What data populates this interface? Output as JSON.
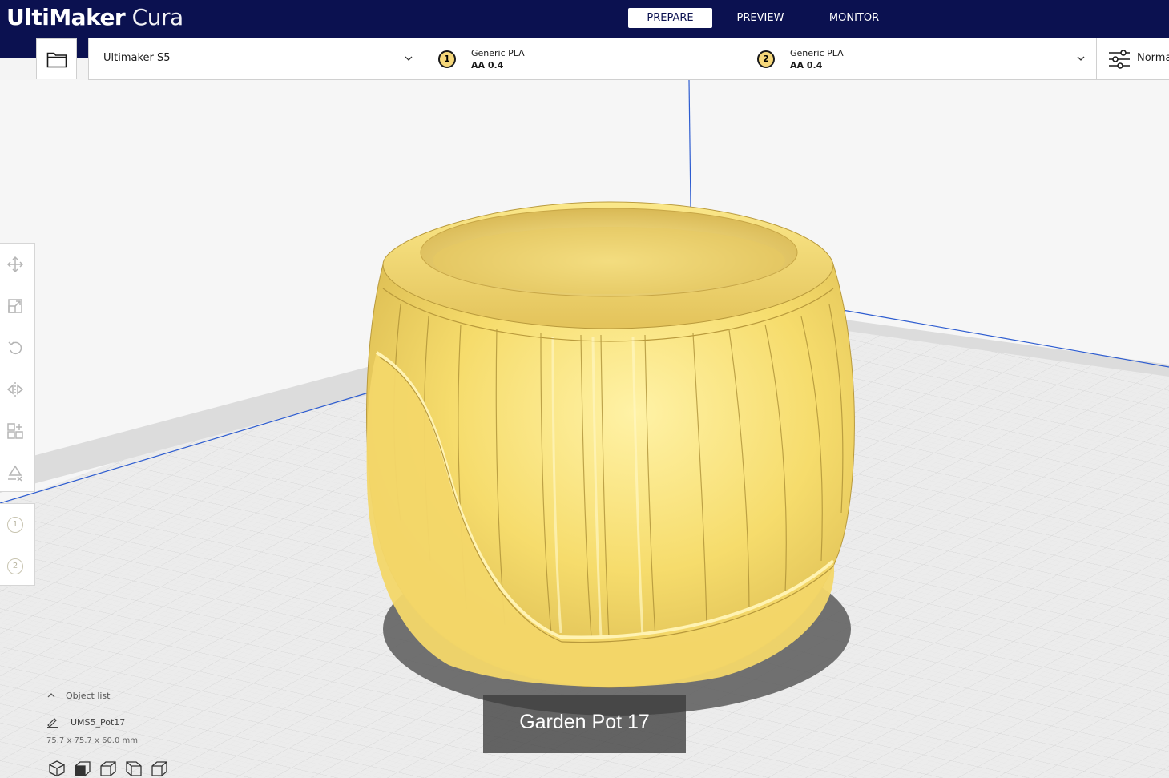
{
  "app": {
    "logo_bold": "UltiMaker",
    "logo_light": "Cura"
  },
  "stages": [
    {
      "label": "PREPARE",
      "active": true
    },
    {
      "label": "PREVIEW",
      "active": false
    },
    {
      "label": "MONITOR",
      "active": false
    }
  ],
  "printer": {
    "name": "Ultimaker S5"
  },
  "extruders": [
    {
      "number": "1",
      "material": "Generic PLA",
      "nozzle": "AA 0.4"
    },
    {
      "number": "2",
      "material": "Generic PLA",
      "nozzle": "AA 0.4"
    }
  ],
  "print_settings": {
    "profile_label": "Norma"
  },
  "object_list": {
    "header": "Object list",
    "item": "UMS5_Pot17",
    "dimensions": "75.7 x 75.7 x 60.0 mm"
  },
  "caption": "Garden Pot 17",
  "colors": {
    "header_bg": "#0b1150",
    "model_yellow": "#f9e27a",
    "build_plate_line": "#2d5cd0"
  },
  "icons": {
    "tools": [
      "move-icon",
      "scale-icon",
      "rotate-icon",
      "mirror-icon",
      "per-model-settings-icon",
      "support-blocker-icon"
    ],
    "view_buttons": [
      "3d-view-icon",
      "front-view-icon",
      "top-view-icon",
      "left-view-icon",
      "right-view-icon"
    ]
  }
}
